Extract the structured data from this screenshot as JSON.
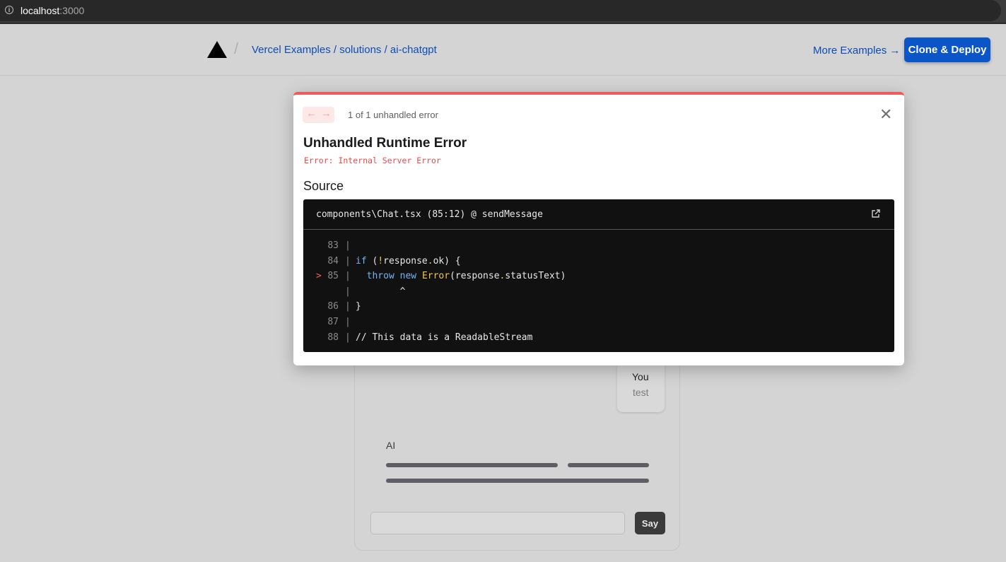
{
  "browser": {
    "url_host": "localhost",
    "url_port": ":3000"
  },
  "nav": {
    "breadcrumbs": "Vercel Examples / solutions / ai-chatgpt",
    "more_examples": "More Examples →",
    "clone_deploy": "Clone & Deploy"
  },
  "overlay": {
    "count_text": "1 of 1 unhandled error",
    "title": "Unhandled Runtime Error",
    "message": "Error: Internal Server Error",
    "source_heading": "Source",
    "file_location": "components\\Chat.tsx (85:12) @ sendMessage",
    "code_lines": [
      {
        "no": "83",
        "code": ""
      },
      {
        "no": "84",
        "code": "if (!response.ok) {"
      },
      {
        "no": "85",
        "code": "  throw new Error(response.statusText)",
        "highlight": true
      },
      {
        "no": "",
        "code": "        ^"
      },
      {
        "no": "86",
        "code": "}"
      },
      {
        "no": "87",
        "code": ""
      },
      {
        "no": "88",
        "code": "// This data is a ReadableStream"
      }
    ]
  },
  "chat": {
    "user_label": "You",
    "user_message": "test",
    "ai_label": "AI",
    "send_label": "Say",
    "input_value": ""
  },
  "colors": {
    "accent": "#0a56c9",
    "error": "#e84a4a",
    "code_bg": "#111111"
  }
}
